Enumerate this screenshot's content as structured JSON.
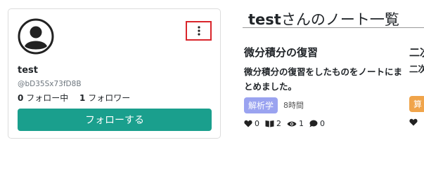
{
  "profile": {
    "username": "test",
    "handle": "@bD35Sx73fD8B",
    "following_count": "0",
    "following_label": "フォロー中",
    "followers_count": "1",
    "followers_label": "フォロワー",
    "follow_button_label": "フォローする"
  },
  "page": {
    "title_user": "test",
    "title_suffix": "さんのノート一覧"
  },
  "notes": [
    {
      "title": "微分積分の復習",
      "description": "微分積分の復習をしたものをノートにまとめました。",
      "tag": "解析学",
      "time": "8時間",
      "likes": "0",
      "bookmarks": "2",
      "views": "1",
      "comments": "0"
    },
    {
      "title": "二次",
      "description": "二次",
      "tag": "算"
    }
  ],
  "colors": {
    "accent": "#1a9f8d",
    "tag_analysis": "#9aa3f0",
    "tag_math": "#f0a44a",
    "highlight_border": "#d9252b"
  }
}
